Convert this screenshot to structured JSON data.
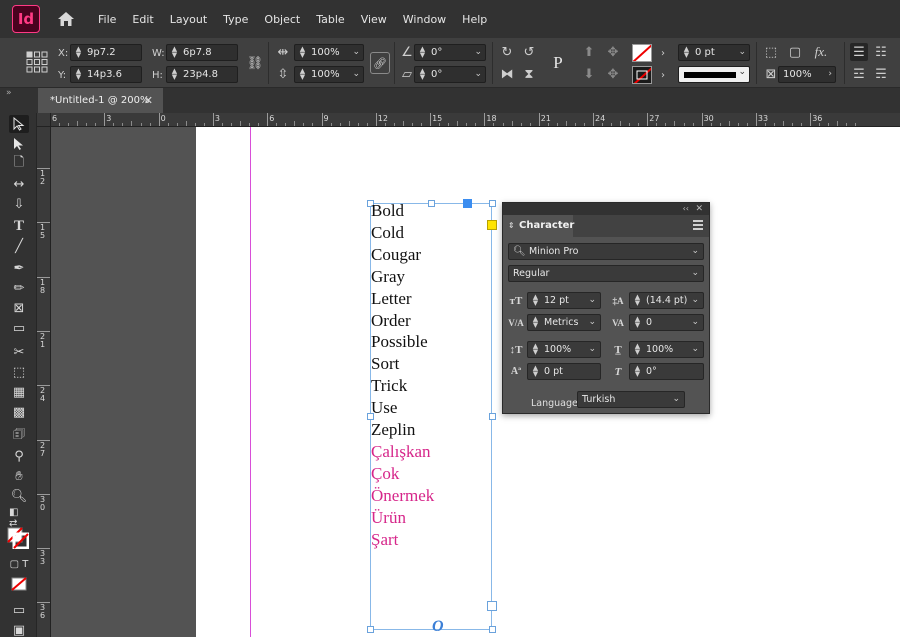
{
  "app": {
    "logo_text": "Id",
    "menu": [
      "File",
      "Edit",
      "Layout",
      "Type",
      "Object",
      "Table",
      "View",
      "Window",
      "Help"
    ]
  },
  "control": {
    "x_label": "X:",
    "x_value": "9p7.2",
    "y_label": "Y:",
    "y_value": "14p3.6",
    "w_label": "W:",
    "w_value": "6p7.8",
    "h_label": "H:",
    "h_value": "23p4.8",
    "scale_x": "100%",
    "scale_y": "100%",
    "rotate": "0°",
    "shear": "0°",
    "stroke_weight": "0 pt",
    "opacity": "100%",
    "p_glyph": "P"
  },
  "document": {
    "tab_title": "*Untitled-1 @ 200%",
    "close_glyph": "✕"
  },
  "ruler": {
    "h_ticks": [
      "6",
      "3",
      "0",
      "3",
      "6",
      "9",
      "12",
      "15",
      "18",
      "21",
      "24",
      "27",
      "30",
      "33",
      "36"
    ],
    "v_ticks": [
      "1\n2",
      "1\n5",
      "1\n8",
      "2\n1",
      "2\n4",
      "2\n7",
      "3\n0",
      "3\n3",
      "3\n6"
    ]
  },
  "text_frame": {
    "words": [
      "Bold",
      "Cold",
      "Cougar",
      "Gray",
      "Letter",
      "Order",
      "Possible",
      "Sort",
      "Trick",
      "Use",
      "Zeplin"
    ],
    "turkish_words": [
      "Çalışkan",
      "Çok",
      "Önermek",
      "Ürün",
      "Şart"
    ],
    "overflow_glyph": "O"
  },
  "character_panel": {
    "title": "Character",
    "font_family": "Minion Pro",
    "font_style": "Regular",
    "font_size": "12 pt",
    "leading": "(14.4 pt)",
    "kerning": "Metrics",
    "tracking": "0",
    "vertical_scale": "100%",
    "horizontal_scale": "100%",
    "baseline_shift": "0 pt",
    "skew": "0°",
    "language_label": "Language:",
    "language": "Turkish"
  },
  "colors": {
    "accent_magenta": "#d6268a",
    "selection_blue": "#88b8e8",
    "app_brand": "#ff3a85"
  }
}
